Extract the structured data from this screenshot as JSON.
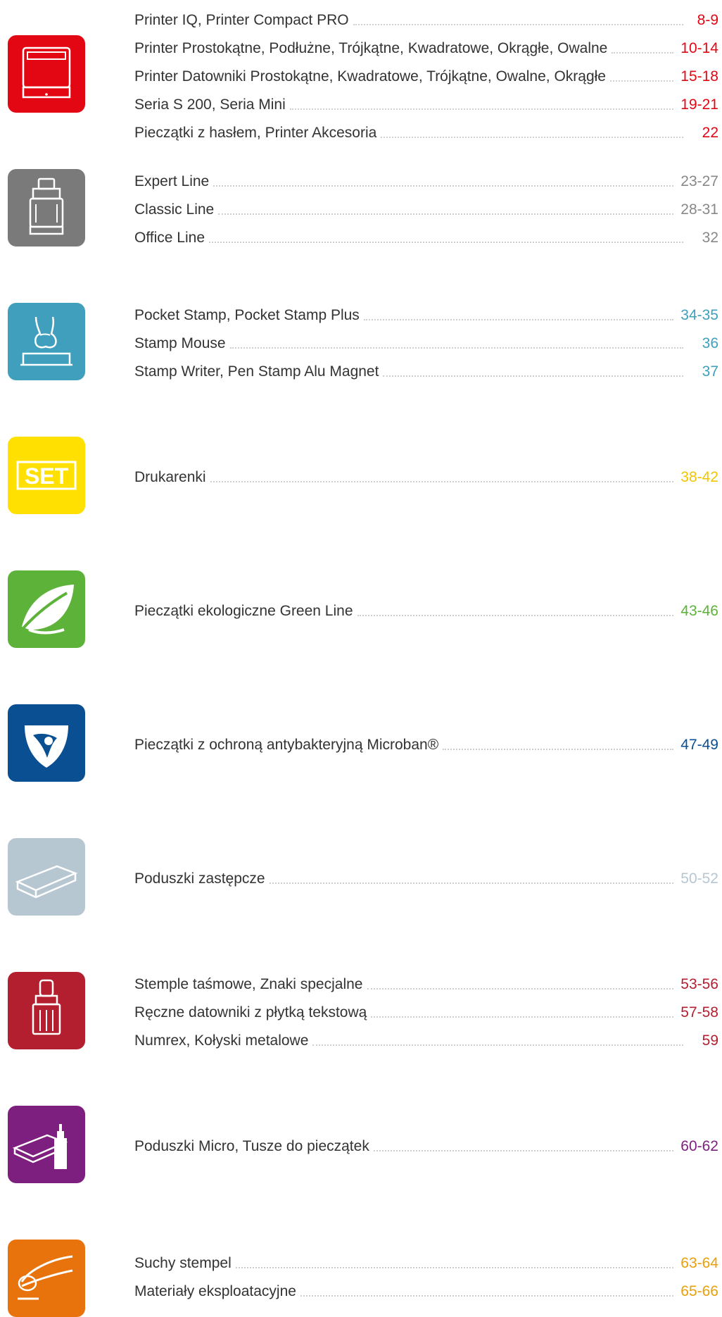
{
  "sections": [
    {
      "color": "#e30613",
      "icon": "self-inking-printer-icon",
      "items": [
        {
          "label": "Printer IQ, Printer Compact PRO",
          "pages": "8-9"
        },
        {
          "label": "Printer Prostokątne, Podłużne, Trójkątne, Kwadratowe, Okrągłe, Owalne",
          "pages": "10-14"
        },
        {
          "label": "Printer Datowniki Prostokątne, Kwadratowe, Trójkątne, Owalne, Okrągłe",
          "pages": "15-18"
        },
        {
          "label": "Seria S 200, Seria Mini",
          "pages": "19-21"
        },
        {
          "label": "Pieczątki z hasłem, Printer Akcesoria",
          "pages": "22"
        }
      ]
    },
    {
      "color": "#7a7a7a",
      "icon": "professional-stamp-icon",
      "items": [
        {
          "label": "Expert Line",
          "pages": "23-27"
        },
        {
          "label": "Classic Line",
          "pages": "28-31"
        },
        {
          "label": "Office Line",
          "pages": "32"
        }
      ]
    },
    {
      "color": "#3f9fbd",
      "icon": "hand-stamp-icon",
      "items": [
        {
          "label": "Pocket Stamp, Pocket Stamp Plus",
          "pages": "34-35"
        },
        {
          "label": "Stamp Mouse",
          "pages": "36"
        },
        {
          "label": "Stamp Writer, Pen Stamp Alu Magnet",
          "pages": "37"
        }
      ]
    },
    {
      "color": "#ffe000",
      "icon": "set-icon",
      "icon_text": "SET",
      "items": [
        {
          "label": "Drukarenki",
          "pages": "38-42"
        }
      ]
    },
    {
      "color": "#5db33a",
      "icon": "leaf-icon",
      "items": [
        {
          "label": "Pieczątki ekologiczne Green Line",
          "pages": "43-46"
        }
      ]
    },
    {
      "color": "#0b4f93",
      "icon": "microban-shield-icon",
      "items": [
        {
          "label": "Pieczątki z ochroną antybakteryjną Microban®",
          "pages": "47-49"
        }
      ]
    },
    {
      "color": "#b7c7d1",
      "icon": "stamp-pad-icon",
      "items": [
        {
          "label": "Poduszki zastępcze",
          "pages": "50-52"
        }
      ]
    },
    {
      "color": "#b31f2e",
      "icon": "band-stamp-icon",
      "items": [
        {
          "label": "Stemple taśmowe, Znaki specjalne",
          "pages": "53-56"
        },
        {
          "label": "Ręczne datowniki z płytką tekstową",
          "pages": "57-58"
        },
        {
          "label": "Numrex, Kołyski metalowe",
          "pages": "59"
        }
      ]
    },
    {
      "color": "#7d1f7f",
      "icon": "ink-pad-bottle-icon",
      "items": [
        {
          "label": "Poduszki Micro, Tusze do pieczątek",
          "pages": "60-62"
        }
      ]
    },
    {
      "color": "#e8730c",
      "icon": "embosser-icon",
      "items": [
        {
          "label": "Suchy stempel",
          "pages": "63-64"
        },
        {
          "label": "Materiały eksploatacyjne",
          "pages": "65-66"
        }
      ]
    }
  ]
}
